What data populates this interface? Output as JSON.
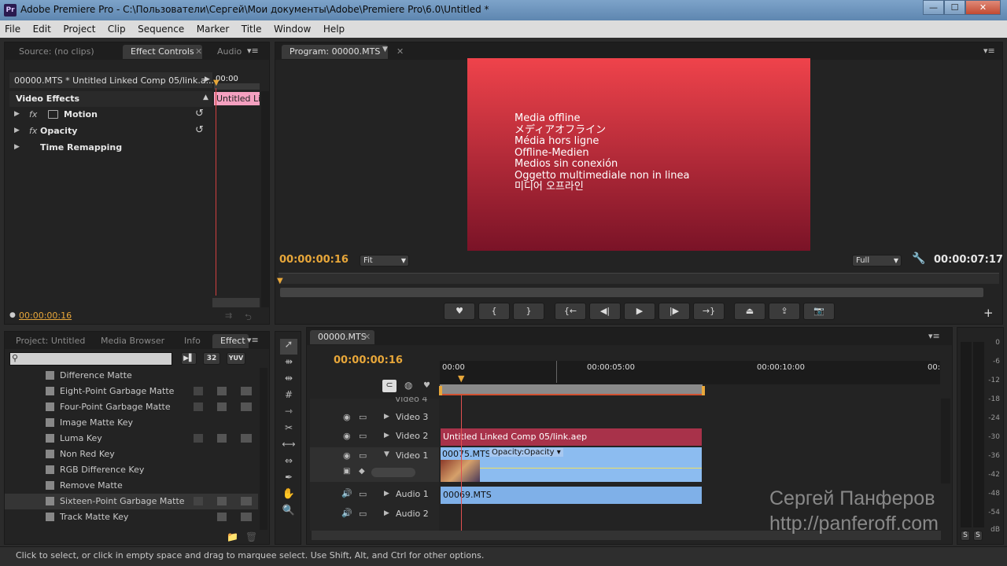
{
  "window": {
    "title": "Adobe Premiere Pro - C:\\Пользователи\\Сергей\\Мои документы\\Adobe\\Premiere Pro\\6.0\\Untitled *",
    "logo": "Pr",
    "min": "—",
    "max": "☐",
    "close": "✕"
  },
  "menu": [
    "File",
    "Edit",
    "Project",
    "Clip",
    "Sequence",
    "Marker",
    "Title",
    "Window",
    "Help"
  ],
  "source_panel": {
    "tabs": [
      "Source: (no clips)",
      "Effect Controls",
      "Audio"
    ],
    "clip_header": "00000.MTS * Untitled Linked Comp 05/link.a...",
    "ruler_time": "00:00",
    "section": "Video Effects",
    "clip_label": "Untitled Li",
    "effects": [
      "Motion",
      "Opacity",
      "Time Remapping"
    ],
    "timecode": "00:00:00:16"
  },
  "program_panel": {
    "tab": "Program: 00000.MTS",
    "offline_lines": [
      "Media offline",
      "メディアオフライン",
      "Média hors ligne",
      "Offline-Medien",
      "Medios sin conexión",
      "Oggetto multimediale non in linea",
      "미디어 오프라인"
    ],
    "timecode_left": "00:00:00:16",
    "fit": "Fit",
    "quality": "Full",
    "timecode_right": "00:00:07:17",
    "controls": [
      "marker-icon",
      "in-point-icon",
      "out-point-icon",
      "go-to-in-icon",
      "step-back-icon",
      "play-icon",
      "step-forward-icon",
      "go-to-out-icon",
      "lift-icon",
      "extract-icon",
      "camera-icon"
    ]
  },
  "project_panel": {
    "tabs": [
      "Project: Untitled",
      "Media Browser",
      "Info",
      "Effect"
    ],
    "search_placeholder": "",
    "badges": [
      "32",
      "YUV"
    ],
    "items": [
      "Difference Matte",
      "Eight-Point Garbage Matte",
      "Four-Point Garbage Matte",
      "Image Matte Key",
      "Luma Key",
      "Non Red Key",
      "RGB Difference Key",
      "Remove Matte",
      "Sixteen-Point Garbage Matte",
      "Track Matte Key"
    ]
  },
  "timeline": {
    "tab": "00000.MTS",
    "timecode": "00:00:00:16",
    "ruler": [
      "00:00",
      "00:00:05:00",
      "00:00:10:00",
      "00:"
    ],
    "tracks": [
      "Video 3",
      "Video 2",
      "Video 1",
      "Audio 1",
      "Audio 2"
    ],
    "partial_track": "Video 4",
    "clips": {
      "v2": "Untitled Linked Comp 05/link.aep",
      "v1": "00075.MTS",
      "v1_fx": "Opacity:Opacity",
      "a1": "00069.MTS"
    }
  },
  "meter_scale": [
    "0",
    "-6",
    "-12",
    "-18",
    "-24",
    "-30",
    "-36",
    "-42",
    "-48",
    "-54",
    "dB"
  ],
  "meter_buttons": [
    "S",
    "S"
  ],
  "watermark": {
    "name": "Сергей Панферов",
    "url": "http://panferoff.com"
  },
  "status": "Click to select, or click in empty space and drag to marquee select. Use Shift, Alt, and Ctrl for other options.",
  "colors": {
    "timecode": "#e8a73a",
    "playhead": "#e05050",
    "video_clip": "#7fb0e8",
    "linked_clip": "#a8324a"
  }
}
